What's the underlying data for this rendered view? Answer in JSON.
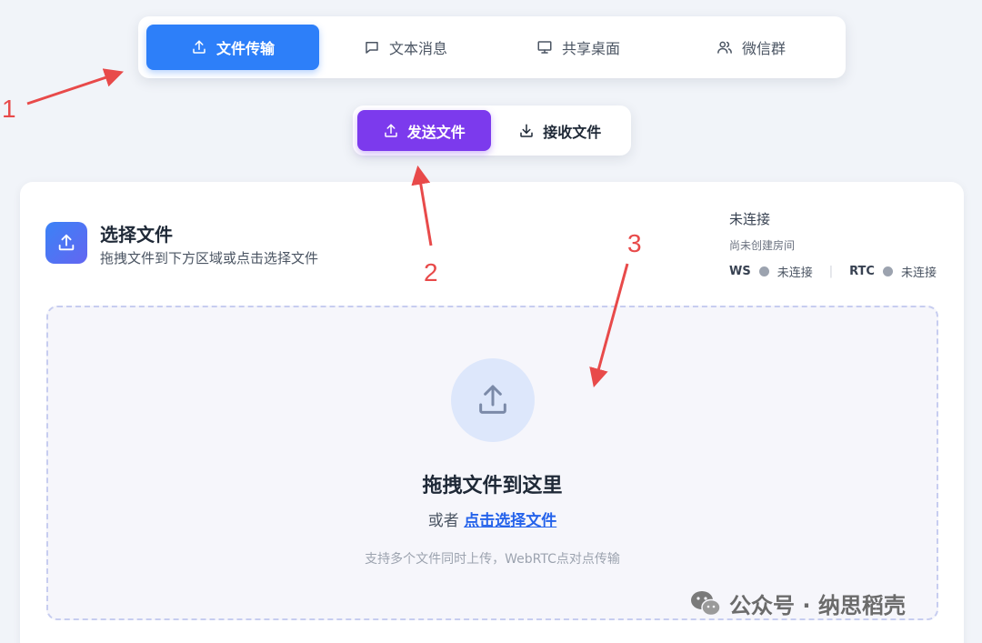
{
  "top_tabs": [
    {
      "label": "文件传输",
      "icon": "upload-icon",
      "active": true
    },
    {
      "label": "文本消息",
      "icon": "message-icon",
      "active": false
    },
    {
      "label": "共享桌面",
      "icon": "monitor-icon",
      "active": false
    },
    {
      "label": "微信群",
      "icon": "users-icon",
      "active": false
    }
  ],
  "sub_tabs": [
    {
      "label": "发送文件",
      "icon": "upload-icon",
      "active": true
    },
    {
      "label": "接收文件",
      "icon": "download-icon",
      "active": false
    }
  ],
  "card": {
    "title": "选择文件",
    "subtitle": "拖拽文件到下方区域或点击选择文件",
    "icon": "upload-icon"
  },
  "status": {
    "main": "未连接",
    "room": "尚未创建房间",
    "ws_label": "WS",
    "ws_state": "未连接",
    "rtc_label": "RTC",
    "rtc_state": "未连接",
    "separator": "|"
  },
  "dropzone": {
    "title": "拖拽文件到这里",
    "or_text": "或者",
    "link_text": "点击选择文件",
    "hint": "支持多个文件同时上传，WebRTC点对点传输"
  },
  "annotations": {
    "one": "1",
    "two": "2",
    "three": "3"
  },
  "watermark": {
    "text": "公众号 · 纳思稻壳",
    "icon": "wechat-icon"
  },
  "colors": {
    "primary_blue": "#2d7ff9",
    "primary_purple": "#7c3aed",
    "annotation_red": "#e84a4a",
    "link_blue": "#2563eb"
  }
}
